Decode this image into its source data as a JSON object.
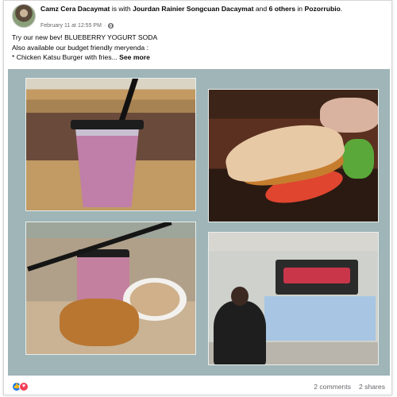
{
  "post": {
    "author": "Camz Cera Dacaymat",
    "connector": "is with",
    "tagged": "Jourdan Rainier Songcuan Dacaymat",
    "and_word": "and",
    "others": "6 others",
    "in_word": "in",
    "location": "Pozorrubio",
    "location_end": ".",
    "timestamp": "February 11 at 12:55 PM",
    "dot": "·",
    "line1": "Try our new bev! BLUEBERRY YOGURT SODA",
    "line2": "Also available our budget friendly meryenda :",
    "line3": "* Chicken Katsu Burger with fries...",
    "see_more": "See more"
  },
  "photos": [
    {
      "icon": "drink-photo"
    },
    {
      "icon": "burger-photo"
    },
    {
      "icon": "meal-photo"
    },
    {
      "icon": "snack-corner-photo"
    }
  ],
  "footer": {
    "reactions": [
      "like-icon",
      "love-icon"
    ],
    "comments": "2 comments",
    "shares": "2 shares"
  },
  "colors": {
    "photo_bg": "#9fb5b7",
    "like": "#1877f2",
    "love": "#f33e58",
    "meta": "#65676b"
  }
}
